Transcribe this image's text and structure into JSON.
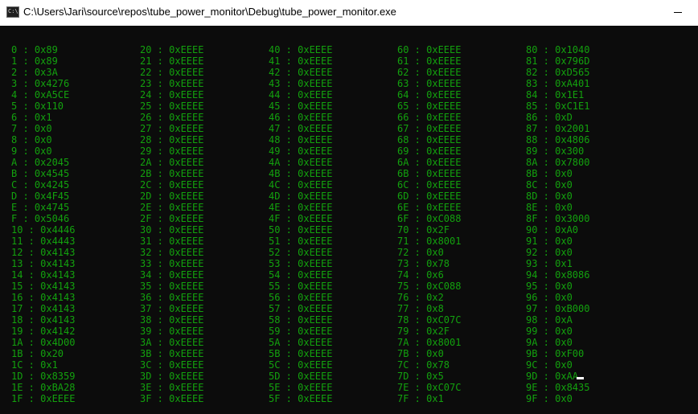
{
  "window": {
    "title": "C:\\Users\\Jari\\source\\repos\\tube_power_monitor\\Debug\\tube_power_monitor.exe",
    "icon": "console-app-icon"
  },
  "console": {
    "text_color": "#13A10E",
    "background_color": "#0C0C0C",
    "columns": [
      [
        "0 : 0x89",
        "1 : 0x89",
        "2 : 0x3A",
        "3 : 0x4276",
        "4 : 0xA5CE",
        "5 : 0x110",
        "6 : 0x1",
        "7 : 0x0",
        "8 : 0x0",
        "9 : 0x0",
        "A : 0x2045",
        "B : 0x4545",
        "C : 0x4245",
        "D : 0x4F45",
        "E : 0x4745",
        "F : 0x5046",
        "10 : 0x4446",
        "11 : 0x4443",
        "12 : 0x4143",
        "13 : 0x4143",
        "14 : 0x4143",
        "15 : 0x4143",
        "16 : 0x4143",
        "17 : 0x4143",
        "18 : 0x4143",
        "19 : 0x4142",
        "1A : 0x4D00",
        "1B : 0x20",
        "1C : 0x1",
        "1D : 0x8359",
        "1E : 0xBA28",
        "1F : 0xEEEE"
      ],
      [
        "20 : 0xEEEE",
        "21 : 0xEEEE",
        "22 : 0xEEEE",
        "23 : 0xEEEE",
        "24 : 0xEEEE",
        "25 : 0xEEEE",
        "26 : 0xEEEE",
        "27 : 0xEEEE",
        "28 : 0xEEEE",
        "29 : 0xEEEE",
        "2A : 0xEEEE",
        "2B : 0xEEEE",
        "2C : 0xEEEE",
        "2D : 0xEEEE",
        "2E : 0xEEEE",
        "2F : 0xEEEE",
        "30 : 0xEEEE",
        "31 : 0xEEEE",
        "32 : 0xEEEE",
        "33 : 0xEEEE",
        "34 : 0xEEEE",
        "35 : 0xEEEE",
        "36 : 0xEEEE",
        "37 : 0xEEEE",
        "38 : 0xEEEE",
        "39 : 0xEEEE",
        "3A : 0xEEEE",
        "3B : 0xEEEE",
        "3C : 0xEEEE",
        "3D : 0xEEEE",
        "3E : 0xEEEE",
        "3F : 0xEEEE"
      ],
      [
        "40 : 0xEEEE",
        "41 : 0xEEEE",
        "42 : 0xEEEE",
        "43 : 0xEEEE",
        "44 : 0xEEEE",
        "45 : 0xEEEE",
        "46 : 0xEEEE",
        "47 : 0xEEEE",
        "48 : 0xEEEE",
        "49 : 0xEEEE",
        "4A : 0xEEEE",
        "4B : 0xEEEE",
        "4C : 0xEEEE",
        "4D : 0xEEEE",
        "4E : 0xEEEE",
        "4F : 0xEEEE",
        "50 : 0xEEEE",
        "51 : 0xEEEE",
        "52 : 0xEEEE",
        "53 : 0xEEEE",
        "54 : 0xEEEE",
        "55 : 0xEEEE",
        "56 : 0xEEEE",
        "57 : 0xEEEE",
        "58 : 0xEEEE",
        "59 : 0xEEEE",
        "5A : 0xEEEE",
        "5B : 0xEEEE",
        "5C : 0xEEEE",
        "5D : 0xEEEE",
        "5E : 0xEEEE",
        "5F : 0xEEEE"
      ],
      [
        "60 : 0xEEEE",
        "61 : 0xEEEE",
        "62 : 0xEEEE",
        "63 : 0xEEEE",
        "64 : 0xEEEE",
        "65 : 0xEEEE",
        "66 : 0xEEEE",
        "67 : 0xEEEE",
        "68 : 0xEEEE",
        "69 : 0xEEEE",
        "6A : 0xEEEE",
        "6B : 0xEEEE",
        "6C : 0xEEEE",
        "6D : 0xEEEE",
        "6E : 0xEEEE",
        "6F : 0xC088",
        "70 : 0x2F",
        "71 : 0x8001",
        "72 : 0x0",
        "73 : 0x78",
        "74 : 0x6",
        "75 : 0xC088",
        "76 : 0x2",
        "77 : 0x8",
        "78 : 0xC07C",
        "79 : 0x2F",
        "7A : 0x8001",
        "7B : 0x0",
        "7C : 0x78",
        "7D : 0x5",
        "7E : 0xC07C",
        "7F : 0x1"
      ],
      [
        "80 : 0x1040",
        "81 : 0x796D",
        "82 : 0xD565",
        "83 : 0xA401",
        "84 : 0x1E1",
        "85 : 0xC1E1",
        "86 : 0xD",
        "87 : 0x2001",
        "88 : 0x4806",
        "89 : 0x300",
        "8A : 0x7800",
        "8B : 0x0",
        "8C : 0x0",
        "8D : 0x0",
        "8E : 0x0",
        "8F : 0x3000",
        "90 : 0xA0",
        "91 : 0x0",
        "92 : 0x0",
        "93 : 0x1",
        "94 : 0x8086",
        "95 : 0x0",
        "96 : 0x0",
        "97 : 0xB000",
        "98 : 0xA",
        "99 : 0x0",
        "9A : 0x0",
        "9B : 0xF00",
        "9C : 0x0",
        "9D : 0xAA",
        "9E : 0x8435",
        "9F : 0x0"
      ]
    ]
  }
}
